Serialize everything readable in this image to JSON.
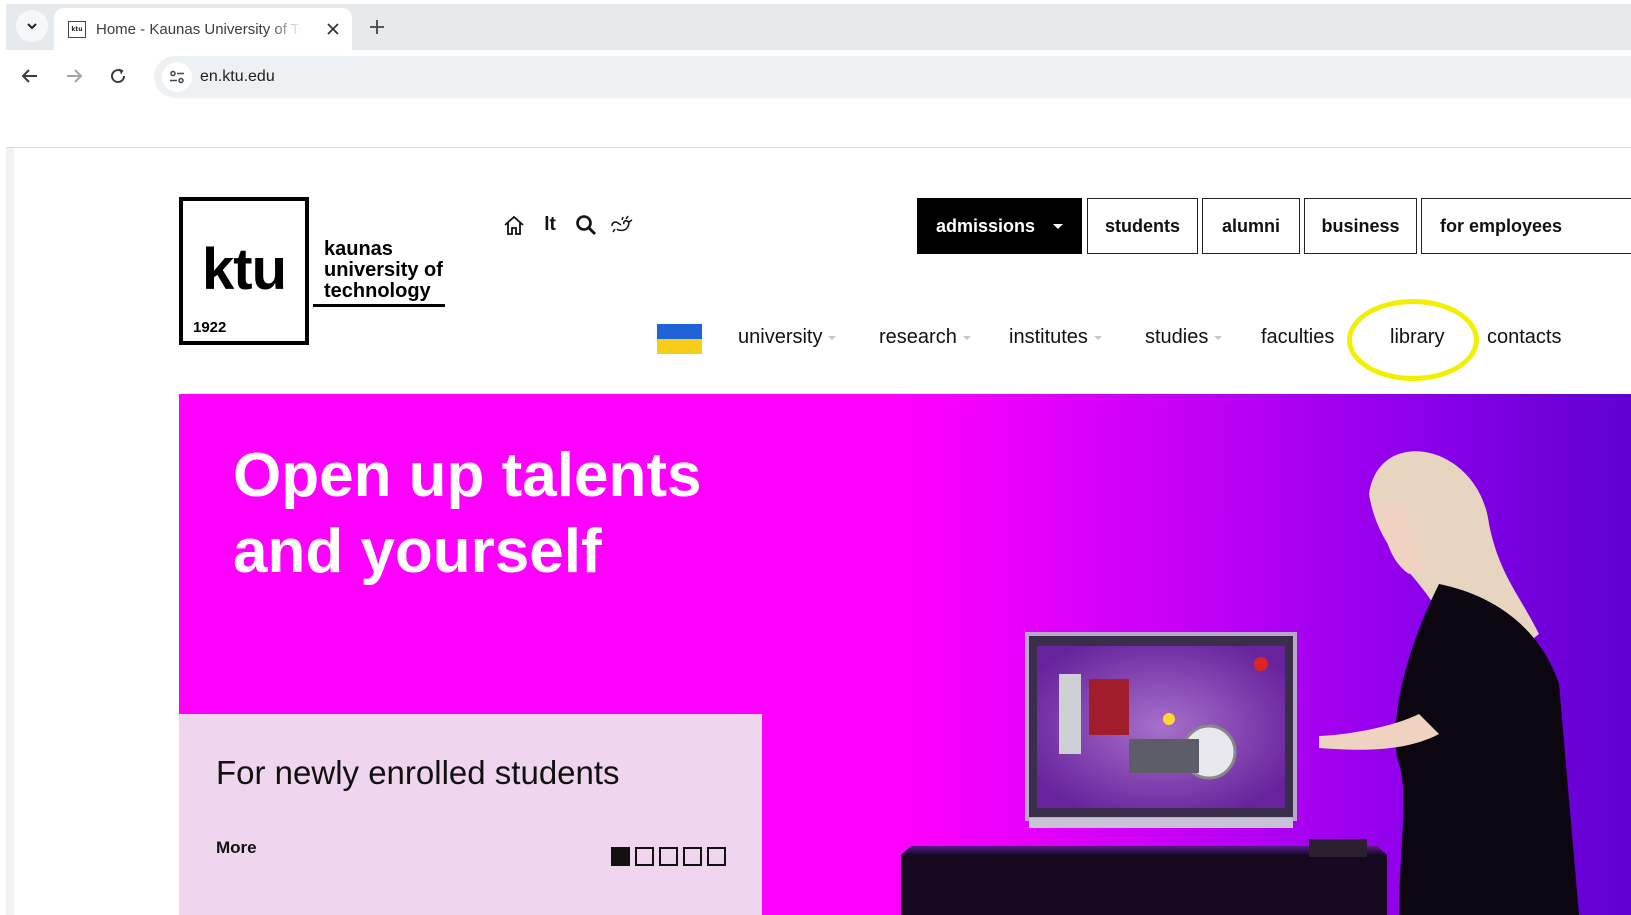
{
  "browser": {
    "tab_title": "Home - Kaunas University of Technology",
    "favicon_text": "ktu",
    "url": "en.ktu.edu",
    "icons": [
      "tab-list-icon",
      "close-icon",
      "plus-icon",
      "back-arrow-icon",
      "forward-arrow-icon",
      "reload-icon",
      "site-info-icon"
    ]
  },
  "site": {
    "logo": {
      "mark": "ktu",
      "year": "1922",
      "name_lines": [
        "kaunas",
        "university of",
        "technology"
      ]
    },
    "utility": {
      "home_icon": "home-icon",
      "language_link": "lt",
      "search_icon": "search-icon",
      "accessibility_icon": "sign-language-icon"
    },
    "audience_nav": {
      "admissions": "admissions",
      "students": "students",
      "alumni": "alumni",
      "business": "business",
      "employees": "for employees"
    },
    "main_menu": {
      "university": "university",
      "research": "research",
      "institutes": "institutes",
      "studies": "studies",
      "faculties": "faculties",
      "library": "library",
      "contacts": "contacts"
    },
    "flag": {
      "top_color": "#1f63d6",
      "bottom_color": "#f7cd17"
    },
    "highlight_color": "#f3ef00",
    "hero": {
      "title_lines": [
        "Open up talents",
        "and yourself"
      ],
      "background_colors": [
        "#ff00ff",
        "#c200f6",
        "#5e00cf"
      ],
      "promo": {
        "title": "For newly enrolled students",
        "more_link": "More",
        "slide_count": 5,
        "active_slide": 1
      }
    }
  }
}
